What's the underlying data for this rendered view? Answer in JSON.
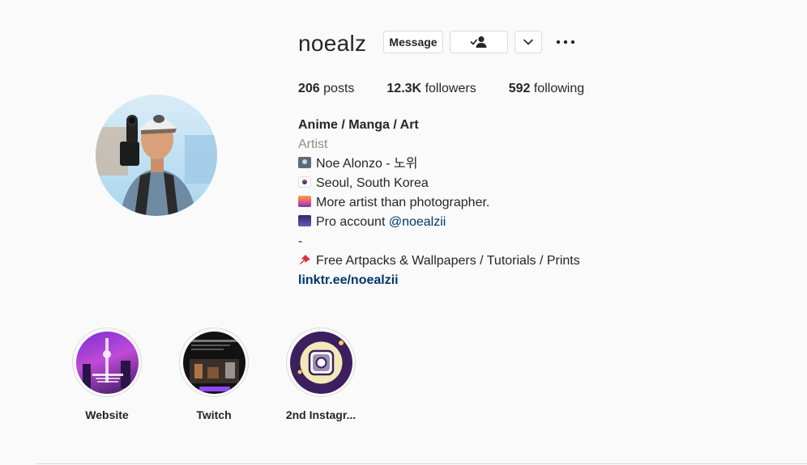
{
  "profile": {
    "username": "noealz",
    "message_label": "Message",
    "following_icon": "person-check-icon",
    "dropdown_icon": "chevron-down-icon",
    "more_icon": "more-options-icon"
  },
  "stats": {
    "posts_count": "206",
    "posts_label": "posts",
    "followers_count": "12.3K",
    "followers_label": "followers",
    "following_count": "592",
    "following_label": "following"
  },
  "bio": {
    "name": "Anime / Manga / Art",
    "category": "Artist",
    "line1": "Noe Alonzo - 노위",
    "line2": "Seoul, South Korea",
    "line3": "More artist than photographer.",
    "line4_prefix": "Pro account",
    "line4_mention": "@noealzii",
    "line5": "-",
    "line6": "Free Artpacks & Wallpapers / Tutorials / Prints",
    "link": "linktr.ee/noealzii"
  },
  "highlights": [
    {
      "label": "Website"
    },
    {
      "label": "Twitch"
    },
    {
      "label": "2nd Instagr..."
    }
  ],
  "colors": {
    "background": "#fafafa",
    "text": "#262626",
    "secondary_text": "#8e8e8e",
    "link": "#00376b",
    "border": "#dbdbdb"
  }
}
